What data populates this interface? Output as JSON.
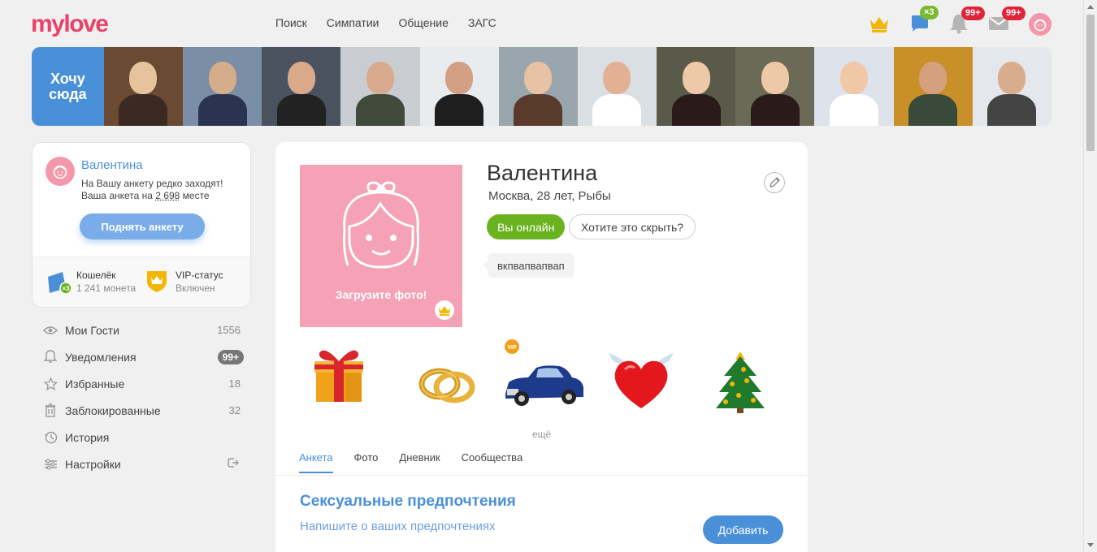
{
  "header": {
    "logo": "mylove",
    "nav": [
      "Поиск",
      "Симпатии",
      "Общение",
      "ЗАГС"
    ],
    "chat_badge": "×3",
    "notifications_badge": "99+",
    "messages_badge": "99+"
  },
  "strip": {
    "want_here_label": "Хочу сюда",
    "thumbs": [
      {
        "bg": "#6a4a32",
        "skin": "#e6c39c",
        "cloth": "#3a2a22"
      },
      {
        "bg": "#7a8fa6",
        "skin": "#d6ad8a",
        "cloth": "#2a3350"
      },
      {
        "bg": "#4a5260",
        "skin": "#d9a98a",
        "cloth": "#222"
      },
      {
        "bg": "#c9cdd2",
        "skin": "#d8a98c",
        "cloth": "#3f4a3a"
      },
      {
        "bg": "#e8ecef",
        "skin": "#d1a085",
        "cloth": "#1e1e1e"
      },
      {
        "bg": "#9aa6ad",
        "skin": "#e7c2a4",
        "cloth": "#5a3a2a"
      },
      {
        "bg": "#dadfe3",
        "skin": "#e2b195",
        "cloth": "#ffffff"
      },
      {
        "bg": "#5a5a4a",
        "skin": "#eec9a8",
        "cloth": "#2a1a1a"
      },
      {
        "bg": "#6a6a56",
        "skin": "#eec9a8",
        "cloth": "#2a1a1a"
      },
      {
        "bg": "#dde3ea",
        "skin": "#f0c8a6",
        "cloth": "#ffffff"
      },
      {
        "bg": "#c9902a",
        "skin": "#d5a07e",
        "cloth": "#3a4a3a"
      },
      {
        "bg": "#e4e8ec",
        "skin": "#d9ac8e",
        "cloth": "#444"
      }
    ]
  },
  "profile_card": {
    "name": "Валентина",
    "msg_line1": "На Вашу анкету редко заходят!",
    "msg_line2_prefix": "Ваша анкета на ",
    "rank": "2 698",
    "msg_line2_suffix": " месте",
    "raise_button": "Поднять анкету",
    "wallet_title": "Кошелёк",
    "wallet_value": "1 241 монета",
    "wallet_badge": "×3",
    "vip_title": "VIP-статус",
    "vip_value": "Включен"
  },
  "menu": [
    {
      "label": "Мои Гости",
      "count": "1556",
      "icon": "eye-icon"
    },
    {
      "label": "Уведомления",
      "pill": "99+",
      "icon": "bell-icon"
    },
    {
      "label": "Избранные",
      "count": "18",
      "icon": "star-icon"
    },
    {
      "label": "Заблокированные",
      "count": "32",
      "icon": "trash-icon"
    },
    {
      "label": "История",
      "icon": "history-icon"
    },
    {
      "label": "Настройки",
      "icon": "settings-icon"
    }
  ],
  "main": {
    "photo_cta": "Загрузите фото!",
    "name": "Валентина",
    "info": "Москва, 28 лет, Рыбы",
    "online_button": "Вы онлайн",
    "hide_button": "Хотите это скрыть?",
    "status_text": "вкпвапвапвап",
    "gifts": [
      "gift-box-icon",
      "wedding-rings-icon",
      "car-icon",
      "winged-heart-icon",
      "christmas-tree-icon"
    ],
    "more_link": "ещё",
    "tabs": [
      "Анкета",
      "Фото",
      "Дневник",
      "Сообщества"
    ],
    "active_tab": 0,
    "section_title": "Сексуальные предпочтения",
    "section_hint": "Напишите о ваших предпочтениях",
    "add_button": "Добавить"
  },
  "colors": {
    "brand": "#e8436a",
    "accent": "#4a90d9",
    "online": "#6ab320",
    "avatar_pink": "#f497ad"
  }
}
